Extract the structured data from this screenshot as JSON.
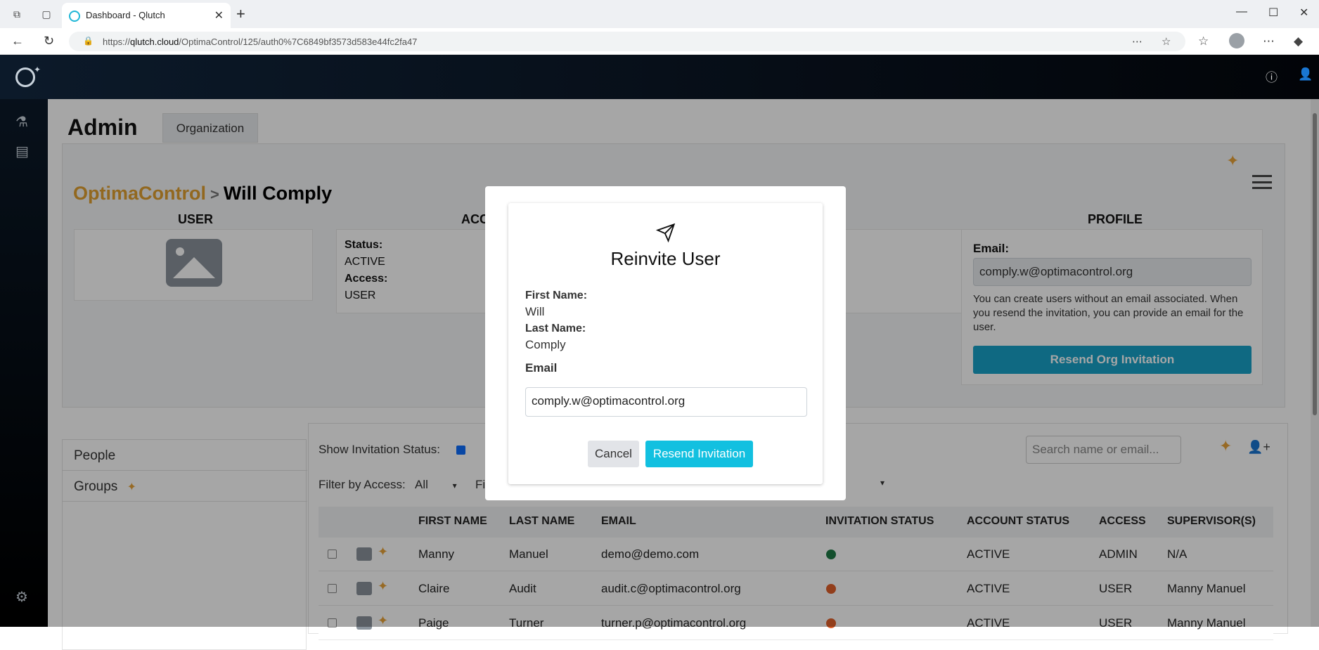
{
  "browser": {
    "tab_title": "Dashboard - Qlutch",
    "url_domain": "qlutch.cloud",
    "url_prefix": "https://",
    "url_path": "/OptimaControl/125/auth0%7C6849bf3573d583e44fc2fa47"
  },
  "page": {
    "title": "Admin",
    "org_tab": "Organization",
    "breadcrumb": {
      "org": "OptimaControl",
      "separator": ">",
      "user": "Will Comply"
    },
    "sections": {
      "user": "USER",
      "account": "ACC",
      "other": "I",
      "profile": "PROFILE"
    },
    "account": {
      "status_label": "Status:",
      "status_value": "ACTIVE",
      "access_label": "Access:",
      "access_value": "USER"
    },
    "profile": {
      "email_label": "Email:",
      "email_value": "comply.w@optimacontrol.org",
      "note": "You can create users without an email associated. When you resend the invitation, you can provide an email for the user.",
      "resend_button": "Resend Org Invitation"
    }
  },
  "left_nav": {
    "items": [
      "People",
      "Groups"
    ]
  },
  "people": {
    "show_invitation_label": "Show Invitation Status:",
    "filter_access_label": "Filter by Access:",
    "filter_access_value": "All",
    "filter2_label": "Fil",
    "search_placeholder": "Search name or email...",
    "columns": [
      "FIRST NAME",
      "LAST NAME",
      "EMAIL",
      "INVITATION STATUS",
      "ACCOUNT STATUS",
      "ACCESS",
      "SUPERVISOR(S)"
    ],
    "rows": [
      {
        "first": "Manny",
        "last": "Manuel",
        "email": "demo@demo.com",
        "invite_color": "#1e7a46",
        "status": "ACTIVE",
        "access": "ADMIN",
        "supervisor": "N/A"
      },
      {
        "first": "Claire",
        "last": "Audit",
        "email": "audit.c@optimacontrol.org",
        "invite_color": "#e0602a",
        "status": "ACTIVE",
        "access": "USER",
        "supervisor": "Manny Manuel"
      },
      {
        "first": "Paige",
        "last": "Turner",
        "email": "turner.p@optimacontrol.org",
        "invite_color": "#e0602a",
        "status": "ACTIVE",
        "access": "USER",
        "supervisor": "Manny Manuel"
      }
    ]
  },
  "modal": {
    "icon": "paper-plane-icon",
    "title": "Reinvite User",
    "first_name_label": "First Name:",
    "first_name_value": "Will",
    "last_name_label": "Last Name:",
    "last_name_value": "Comply",
    "email_label": "Email",
    "email_value": "comply.w@optimacontrol.org",
    "cancel_label": "Cancel",
    "resend_label": "Resend Invitation"
  },
  "colors": {
    "accent": "#12c0e0",
    "brand_org": "#e0a030",
    "sparkle": "#e8a33a"
  }
}
